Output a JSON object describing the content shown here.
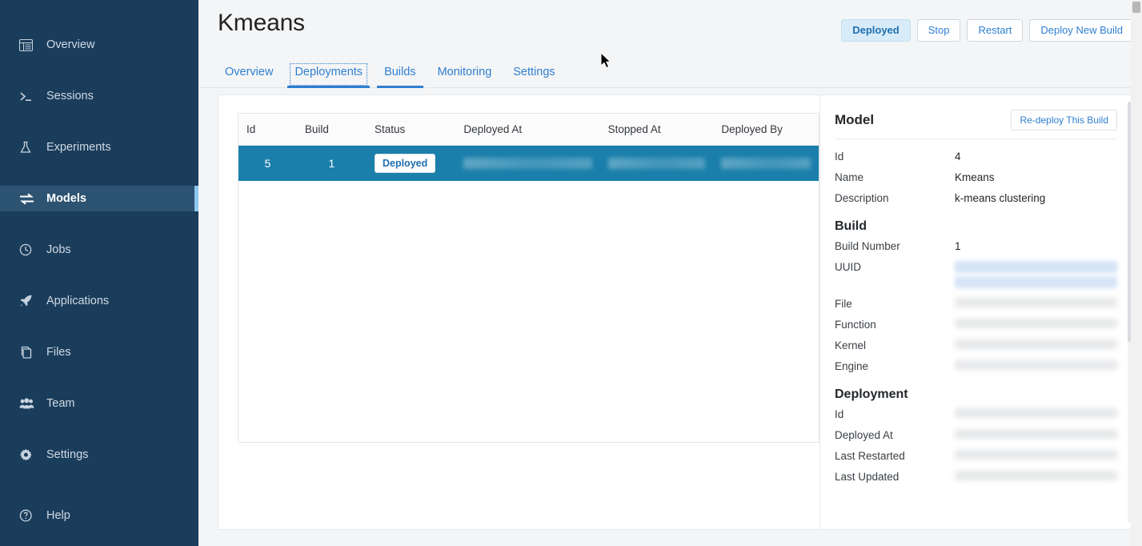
{
  "sidebar": {
    "items": [
      {
        "label": "Overview",
        "icon": "overview-icon",
        "active": false
      },
      {
        "label": "Sessions",
        "icon": "terminal-icon",
        "active": false
      },
      {
        "label": "Experiments",
        "icon": "flask-icon",
        "active": false
      },
      {
        "label": "Models",
        "icon": "exchange-icon",
        "active": true
      },
      {
        "label": "Jobs",
        "icon": "clock-icon",
        "active": false
      },
      {
        "label": "Applications",
        "icon": "rocket-icon",
        "active": false
      },
      {
        "label": "Files",
        "icon": "files-icon",
        "active": false
      },
      {
        "label": "Team",
        "icon": "people-icon",
        "active": false
      },
      {
        "label": "Settings",
        "icon": "gear-icon",
        "active": false
      }
    ],
    "help": {
      "label": "Help",
      "icon": "help-circle-icon"
    },
    "active_color": "#8ec8f0",
    "background": "#1b3d5c"
  },
  "header": {
    "title": "Kmeans",
    "actions": {
      "status_label": "Deployed",
      "stop_label": "Stop",
      "restart_label": "Restart",
      "deploy_new_build_label": "Deploy New Build"
    }
  },
  "tabs": [
    {
      "label": "Overview",
      "underlined": false,
      "focused": false
    },
    {
      "label": "Deployments",
      "underlined": true,
      "focused": true
    },
    {
      "label": "Builds",
      "underlined": true,
      "focused": false
    },
    {
      "label": "Monitoring",
      "underlined": false,
      "focused": false
    },
    {
      "label": "Settings",
      "underlined": false,
      "focused": false
    }
  ],
  "table": {
    "columns": [
      "Id",
      "Build",
      "Status",
      "Deployed At",
      "Stopped At",
      "Deployed By"
    ],
    "rows": [
      {
        "id": "5",
        "build": "1",
        "status": "Deployed",
        "deployed_at": "",
        "stopped_at": "",
        "deployed_by": "",
        "selected": true
      }
    ]
  },
  "details": {
    "heading": "Model",
    "redeploy_label": "Re-deploy This Build",
    "sections": [
      {
        "title": "",
        "fields": [
          {
            "key": "Id",
            "value": "4",
            "redacted": false
          },
          {
            "key": "Name",
            "value": "Kmeans",
            "redacted": false
          },
          {
            "key": "Description",
            "value": "k-means clustering",
            "redacted": false
          }
        ]
      },
      {
        "title": "Build",
        "fields": [
          {
            "key": "Build Number",
            "value": "1",
            "redacted": false
          },
          {
            "key": "UUID",
            "value": "",
            "redacted": true,
            "selected": true
          },
          {
            "key": "File",
            "value": "",
            "redacted": true
          },
          {
            "key": "Function",
            "value": "",
            "redacted": true
          },
          {
            "key": "Kernel",
            "value": "",
            "redacted": true
          },
          {
            "key": "Engine",
            "value": "",
            "redacted": true
          }
        ]
      },
      {
        "title": "Deployment",
        "fields": [
          {
            "key": "Id",
            "value": "",
            "redacted": true
          },
          {
            "key": "Deployed At",
            "value": "",
            "redacted": true
          },
          {
            "key": "Last Restarted",
            "value": "",
            "redacted": true
          },
          {
            "key": "Last Updated",
            "value": "",
            "redacted": true
          }
        ]
      }
    ]
  },
  "colors": {
    "accent": "#2f7fd1",
    "sidebar_bg": "#1b3d5c",
    "selected_row": "#1a7fab",
    "page_bg": "#f4f5f6"
  }
}
